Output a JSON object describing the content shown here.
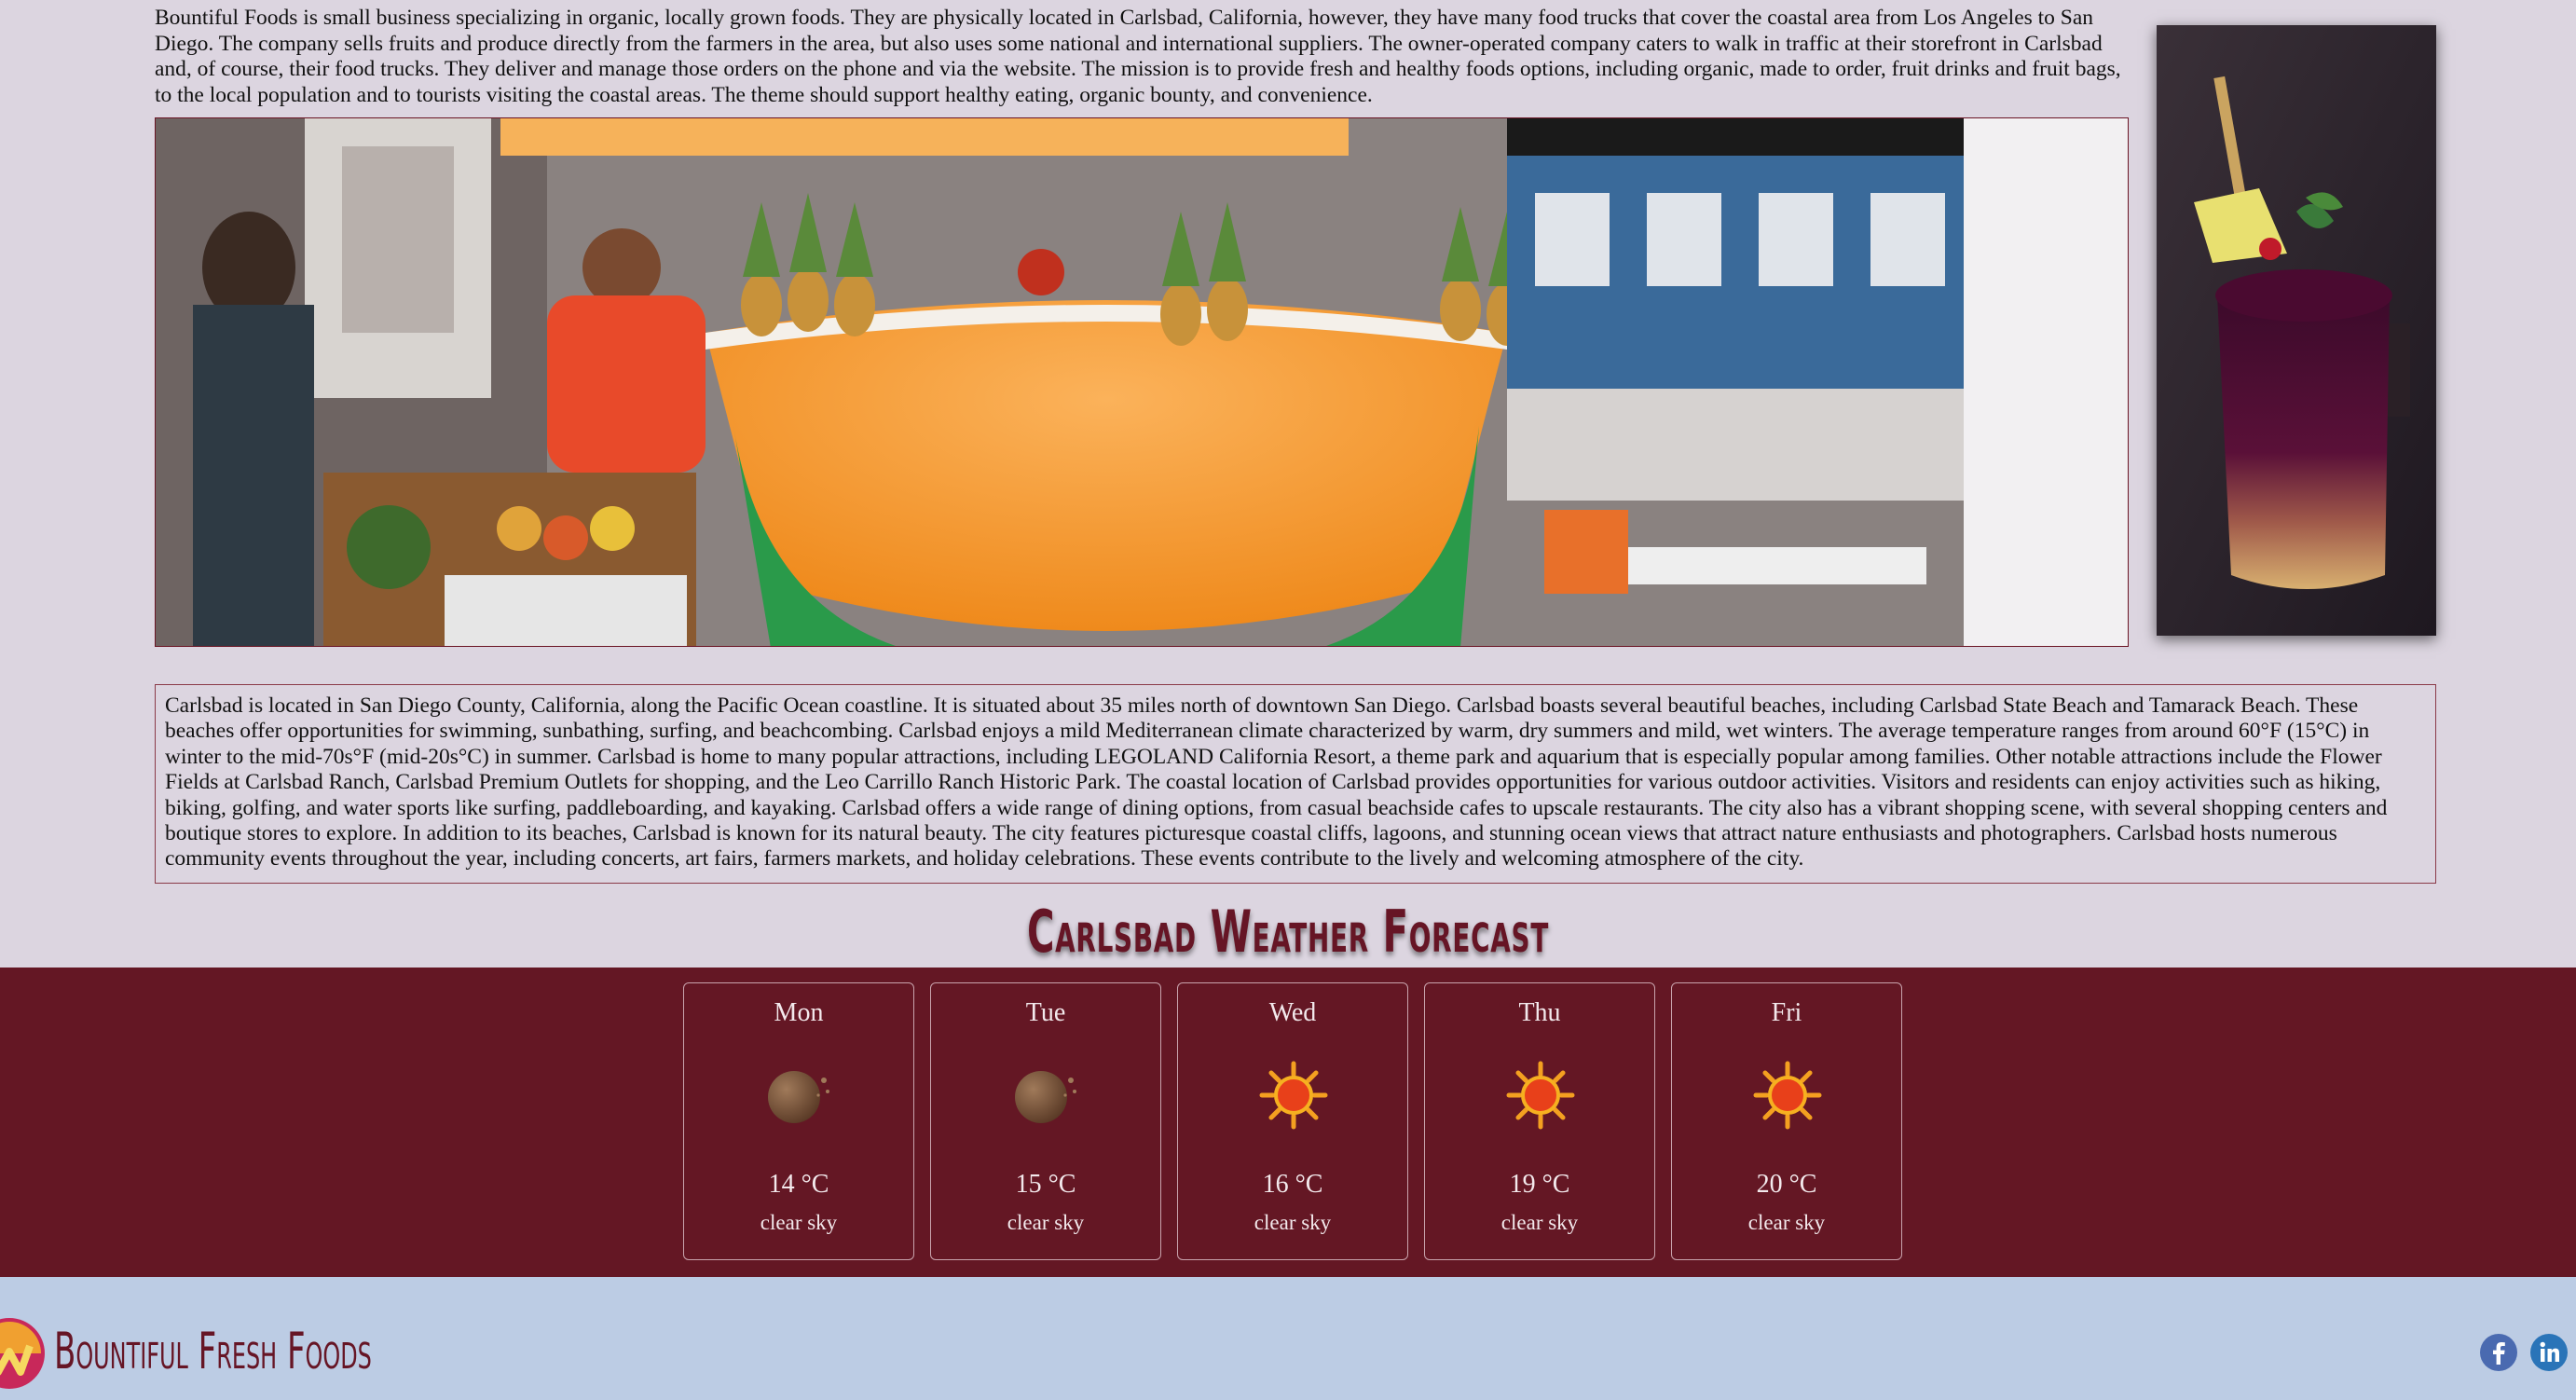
{
  "intro_text": "Bountiful Foods is small business specializing in organic, locally grown foods. They are physically located in Carlsbad, California, however, they have many food trucks that cover the coastal area from Los Angeles to San Diego. The company sells fruits and produce directly from the farmers in the area, but also uses some national and international suppliers. The owner-operated company caters to walk in traffic at their storefront in Carlsbad and, of course, their food trucks. They deliver and manage those orders on the phone and via the website. The mission is to provide fresh and healthy foods options, including organic, made to order, fruit drinks and fruit bags, to the local population and to tourists visiting the coastal areas. The theme should support healthy eating, organic bounty, and convenience.",
  "carlsbad_text": "Carlsbad is located in San Diego County, California, along the Pacific Ocean coastline. It is situated about 35 miles north of downtown San Diego. Carlsbad boasts several beautiful beaches, including Carlsbad State Beach and Tamarack Beach. These beaches offer opportunities for swimming, sunbathing, surfing, and beachcombing. Carlsbad enjoys a mild Mediterranean climate characterized by warm, dry summers and mild, wet winters. The average temperature ranges from around 60°F (15°C) in winter to the mid-70s°F (mid-20s°C) in summer. Carlsbad is home to many popular attractions, including LEGOLAND California Resort, a theme park and aquarium that is especially popular among families. Other notable attractions include the Flower Fields at Carlsbad Ranch, Carlsbad Premium Outlets for shopping, and the Leo Carrillo Ranch Historic Park. The coastal location of Carlsbad provides opportunities for various outdoor activities. Visitors and residents can enjoy activities such as hiking, biking, golfing, and water sports like surfing, paddleboarding, and kayaking. Carlsbad offers a wide range of dining options, from casual beachside cafes to upscale restaurants. The city also has a vibrant shopping scene, with several shopping centers and boutique stores to explore. In addition to its beaches, Carlsbad is known for its natural beauty. The city features picturesque coastal cliffs, lagoons, and stunning ocean views that attract nature enthusiasts and photographers. Carlsbad hosts numerous community events throughout the year, including concerts, art fairs, farmers markets, and holiday celebrations. These events contribute to the lively and welcoming atmosphere of the city.",
  "forecast_title": "Carlsbad Weather Forecast",
  "forecast": [
    {
      "day": "Mon",
      "temp": "14 °C",
      "desc": "clear sky",
      "icon": "moon-clear-icon"
    },
    {
      "day": "Tue",
      "temp": "15 °C",
      "desc": "clear sky",
      "icon": "moon-clear-icon"
    },
    {
      "day": "Wed",
      "temp": "16 °C",
      "desc": "clear sky",
      "icon": "sun-icon"
    },
    {
      "day": "Thu",
      "temp": "19 °C",
      "desc": "clear sky",
      "icon": "sun-icon"
    },
    {
      "day": "Fri",
      "temp": "20 °C",
      "desc": "clear sky",
      "icon": "sun-icon"
    }
  ],
  "footer": {
    "brand": "Bountiful Fresh Foods",
    "social": [
      "facebook-icon",
      "linkedin-icon"
    ]
  },
  "colors": {
    "page_bg": "#dcd5e0",
    "brand_maroon": "#641724",
    "footer_bg": "#bccce4",
    "card_text": "#f3e9ec"
  }
}
